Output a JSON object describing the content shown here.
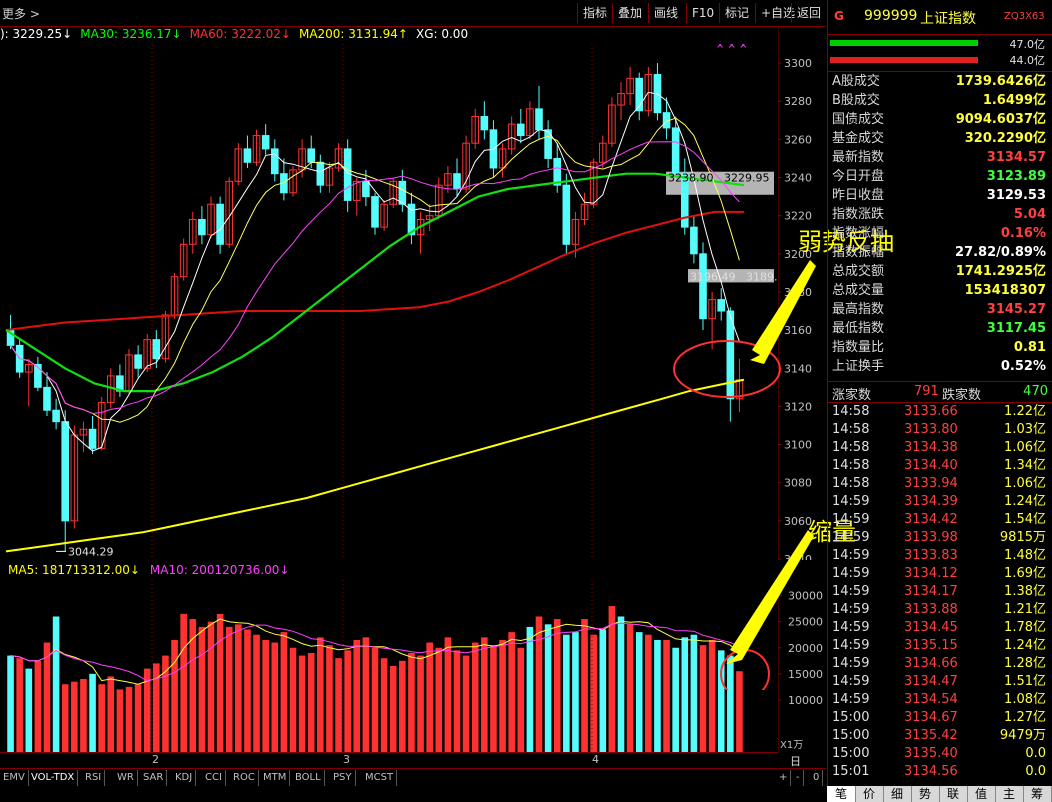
{
  "toolbar": {
    "more": "更多 >",
    "buttons": [
      "指标",
      "叠加",
      "画线",
      "F10",
      "标记",
      "+自选",
      "返回"
    ]
  },
  "ma_legend": [
    {
      "text": "): 3229.25↓",
      "color": "#ffffff"
    },
    {
      "text": "MA30: 3236.17↓",
      "color": "#00ff00"
    },
    {
      "text": "MA60: 3222.02↓",
      "color": "#ff3030"
    },
    {
      "text": "MA200: 3131.94↑",
      "color": "#ffff00"
    },
    {
      "text": "XG: 0.00",
      "color": "#ffffff"
    }
  ],
  "vol_legend": [
    {
      "text": "MA5: 181713312.00↓",
      "color": "#ffff00"
    },
    {
      "text": "MA10: 200120736.00↓",
      "color": "#ff40ff"
    }
  ],
  "price_axis": [
    "3300",
    "3280",
    "3260",
    "3240",
    "3220",
    "3200",
    "3180",
    "3160",
    "3140",
    "3120",
    "3100",
    "3080",
    "3060",
    "3040"
  ],
  "vol_axis": [
    "30000",
    "25000",
    "20000",
    "15000",
    "10000"
  ],
  "vol_unit": "X1万",
  "date_labels": [
    "2",
    "3",
    "4"
  ],
  "period": "日线",
  "chart_labels": {
    "min_label": "3044.29",
    "gap1": "3238.90",
    "gap1b": "3229.95",
    "gap2": "3196.49",
    "gap2b": "3189.",
    "marks": "× × ×"
  },
  "annotations": {
    "weak_rebound": "弱势反抽",
    "shrink_volume": "缩量"
  },
  "indicator_tabs": [
    "EMV",
    "VOL-TDX",
    "RSI",
    "WR",
    "SAR",
    "KDJ",
    "CCI",
    "ROC",
    "MTM",
    "BOLL",
    "PSY",
    "MCST"
  ],
  "indicator_nav": [
    "+",
    "-",
    "0"
  ],
  "right_panel": {
    "header_g": "G",
    "code": "999999",
    "name": "上证指数",
    "tag": "ZQ3X63",
    "ratio_up": "47.0亿",
    "ratio_dn": "44.0亿",
    "stats": [
      {
        "label": "A股成交",
        "value": "1739.6426亿",
        "color": "#ffff40"
      },
      {
        "label": "B股成交",
        "value": "1.6499亿",
        "color": "#ffff40"
      },
      {
        "label": "国债成交",
        "value": "9094.6037亿",
        "color": "#ffff40"
      },
      {
        "label": "基金成交",
        "value": "320.2290亿",
        "color": "#ffff40"
      },
      {
        "label": "最新指数",
        "value": "3134.57",
        "color": "#ff4040"
      },
      {
        "label": "今日开盘",
        "value": "3123.89",
        "color": "#40ff40"
      },
      {
        "label": "昨日收盘",
        "value": "3129.53",
        "color": "#ffffff"
      },
      {
        "label": "指数涨跌",
        "value": "5.04",
        "color": "#ff4040"
      },
      {
        "label": "指数涨幅",
        "value": "0.16%",
        "color": "#ff4040"
      },
      {
        "label": "指数振幅",
        "value": "27.82/0.89%",
        "color": "#ffffff"
      },
      {
        "label": "总成交额",
        "value": "1741.2925亿",
        "color": "#ffff40"
      },
      {
        "label": "总成交量",
        "value": "153418307",
        "color": "#ffff40"
      },
      {
        "label": "最高指数",
        "value": "3145.27",
        "color": "#ff4040"
      },
      {
        "label": "最低指数",
        "value": "3117.45",
        "color": "#40ff40"
      },
      {
        "label": "指数量比",
        "value": "0.81",
        "color": "#ffff40"
      },
      {
        "label": "上证换手",
        "value": "0.52%",
        "color": "#ffffff"
      }
    ],
    "up_label": "涨家数",
    "up_count": "791",
    "down_label": "跌家数",
    "down_count": "470",
    "ticks": [
      {
        "t": "14:58",
        "p": "3133.66",
        "v": "1.22亿"
      },
      {
        "t": "14:58",
        "p": "3133.80",
        "v": "1.03亿"
      },
      {
        "t": "14:58",
        "p": "3134.38",
        "v": "1.06亿"
      },
      {
        "t": "14:58",
        "p": "3134.40",
        "v": "1.34亿"
      },
      {
        "t": "14:58",
        "p": "3133.94",
        "v": "1.06亿"
      },
      {
        "t": "14:59",
        "p": "3134.39",
        "v": "1.24亿"
      },
      {
        "t": "14:59",
        "p": "3134.42",
        "v": "1.54亿"
      },
      {
        "t": "14:59",
        "p": "3133.98",
        "v": "9815万"
      },
      {
        "t": "14:59",
        "p": "3133.83",
        "v": "1.48亿"
      },
      {
        "t": "14:59",
        "p": "3134.12",
        "v": "1.69亿"
      },
      {
        "t": "14:59",
        "p": "3134.17",
        "v": "1.38亿"
      },
      {
        "t": "14:59",
        "p": "3133.88",
        "v": "1.21亿"
      },
      {
        "t": "14:59",
        "p": "3134.45",
        "v": "1.78亿"
      },
      {
        "t": "14:59",
        "p": "3135.15",
        "v": "1.24亿"
      },
      {
        "t": "14:59",
        "p": "3134.66",
        "v": "1.28亿"
      },
      {
        "t": "14:59",
        "p": "3134.47",
        "v": "1.51亿"
      },
      {
        "t": "14:59",
        "p": "3134.54",
        "v": "1.08亿"
      },
      {
        "t": "15:00",
        "p": "3134.67",
        "v": "1.27亿"
      },
      {
        "t": "15:00",
        "p": "3135.42",
        "v": "9479万"
      },
      {
        "t": "15:00",
        "p": "3135.40",
        "v": "0.0"
      },
      {
        "t": "15:01",
        "p": "3134.56",
        "v": "0.0"
      }
    ],
    "bottom_tabs": [
      "笔",
      "价",
      "细",
      "势",
      "联",
      "值",
      "主",
      "筹"
    ]
  },
  "chart_data": {
    "type": "candlestick",
    "price_range": [
      3040,
      3310
    ],
    "candles": [
      [
        3160,
        3168,
        3150,
        3152
      ],
      [
        3152,
        3155,
        3135,
        3138
      ],
      [
        3138,
        3145,
        3120,
        3142
      ],
      [
        3142,
        3146,
        3128,
        3130
      ],
      [
        3130,
        3138,
        3115,
        3118
      ],
      [
        3118,
        3124,
        3108,
        3112
      ],
      [
        3112,
        3118,
        3044,
        3060
      ],
      [
        3060,
        3110,
        3056,
        3105
      ],
      [
        3105,
        3112,
        3096,
        3108
      ],
      [
        3108,
        3115,
        3095,
        3098
      ],
      [
        3098,
        3125,
        3097,
        3122
      ],
      [
        3122,
        3140,
        3119,
        3136
      ],
      [
        3136,
        3142,
        3125,
        3128
      ],
      [
        3128,
        3150,
        3126,
        3147
      ],
      [
        3147,
        3152,
        3135,
        3140
      ],
      [
        3140,
        3158,
        3138,
        3155
      ],
      [
        3155,
        3160,
        3140,
        3145
      ],
      [
        3145,
        3170,
        3143,
        3168
      ],
      [
        3168,
        3190,
        3166,
        3188
      ],
      [
        3188,
        3208,
        3186,
        3205
      ],
      [
        3205,
        3222,
        3200,
        3218
      ],
      [
        3218,
        3225,
        3205,
        3210
      ],
      [
        3210,
        3230,
        3208,
        3226
      ],
      [
        3226,
        3230,
        3200,
        3205
      ],
      [
        3205,
        3240,
        3203,
        3238
      ],
      [
        3238,
        3258,
        3236,
        3255
      ],
      [
        3255,
        3262,
        3245,
        3248
      ],
      [
        3248,
        3265,
        3246,
        3262
      ],
      [
        3262,
        3268,
        3252,
        3255
      ],
      [
        3255,
        3260,
        3238,
        3242
      ],
      [
        3242,
        3250,
        3228,
        3232
      ],
      [
        3232,
        3246,
        3230,
        3244
      ],
      [
        3244,
        3260,
        3240,
        3255
      ],
      [
        3255,
        3262,
        3245,
        3248
      ],
      [
        3248,
        3252,
        3232,
        3236
      ],
      [
        3236,
        3248,
        3232,
        3245
      ],
      [
        3245,
        3258,
        3243,
        3255
      ],
      [
        3255,
        3260,
        3222,
        3228
      ],
      [
        3228,
        3240,
        3220,
        3238
      ],
      [
        3238,
        3244,
        3225,
        3230
      ],
      [
        3230,
        3232,
        3210,
        3214
      ],
      [
        3214,
        3228,
        3212,
        3226
      ],
      [
        3226,
        3240,
        3224,
        3238
      ],
      [
        3238,
        3244,
        3222,
        3226
      ],
      [
        3226,
        3232,
        3205,
        3210
      ],
      [
        3210,
        3222,
        3200,
        3218
      ],
      [
        3218,
        3226,
        3212,
        3220
      ],
      [
        3220,
        3240,
        3218,
        3236
      ],
      [
        3236,
        3246,
        3232,
        3242
      ],
      [
        3242,
        3250,
        3230,
        3234
      ],
      [
        3234,
        3262,
        3232,
        3258
      ],
      [
        3258,
        3276,
        3255,
        3272
      ],
      [
        3272,
        3280,
        3260,
        3265
      ],
      [
        3265,
        3270,
        3240,
        3245
      ],
      [
        3245,
        3258,
        3240,
        3255
      ],
      [
        3255,
        3272,
        3252,
        3268
      ],
      [
        3268,
        3276,
        3258,
        3262
      ],
      [
        3262,
        3280,
        3260,
        3276
      ],
      [
        3276,
        3288,
        3260,
        3265
      ],
      [
        3265,
        3270,
        3245,
        3250
      ],
      [
        3250,
        3258,
        3232,
        3236
      ],
      [
        3236,
        3242,
        3200,
        3205
      ],
      [
        3205,
        3222,
        3198,
        3218
      ],
      [
        3218,
        3232,
        3215,
        3226
      ],
      [
        3226,
        3250,
        3224,
        3248
      ],
      [
        3248,
        3262,
        3245,
        3258
      ],
      [
        3258,
        3282,
        3256,
        3278
      ],
      [
        3278,
        3290,
        3270,
        3284
      ],
      [
        3284,
        3298,
        3278,
        3292
      ],
      [
        3292,
        3295,
        3270,
        3275
      ],
      [
        3275,
        3298,
        3272,
        3294
      ],
      [
        3294,
        3300,
        3270,
        3274
      ],
      [
        3274,
        3282,
        3260,
        3266
      ],
      [
        3266,
        3272,
        3238,
        3242
      ],
      [
        3242,
        3250,
        3210,
        3214
      ],
      [
        3214,
        3220,
        3195,
        3200
      ],
      [
        3200,
        3206,
        3160,
        3166
      ],
      [
        3166,
        3180,
        3150,
        3176
      ],
      [
        3176,
        3182,
        3165,
        3170
      ],
      [
        3170,
        3172,
        3112,
        3124
      ],
      [
        3124,
        3145,
        3117,
        3134
      ]
    ],
    "volumes": [
      [
        18500,
        1
      ],
      [
        18000,
        0
      ],
      [
        16000,
        1
      ],
      [
        17500,
        0
      ],
      [
        21000,
        0
      ],
      [
        26000,
        1
      ],
      [
        13000,
        0
      ],
      [
        13500,
        0
      ],
      [
        14000,
        0
      ],
      [
        15000,
        1
      ],
      [
        13000,
        0
      ],
      [
        14500,
        0
      ],
      [
        12000,
        0
      ],
      [
        12500,
        0
      ],
      [
        13000,
        0
      ],
      [
        16000,
        0
      ],
      [
        17000,
        0
      ],
      [
        18500,
        0
      ],
      [
        21500,
        0
      ],
      [
        26500,
        0
      ],
      [
        25500,
        0
      ],
      [
        24000,
        0
      ],
      [
        25000,
        0
      ],
      [
        26500,
        0
      ],
      [
        24000,
        0
      ],
      [
        24500,
        0
      ],
      [
        23500,
        0
      ],
      [
        22500,
        0
      ],
      [
        21500,
        0
      ],
      [
        21000,
        0
      ],
      [
        23000,
        0
      ],
      [
        20000,
        0
      ],
      [
        18500,
        0
      ],
      [
        19000,
        0
      ],
      [
        22000,
        0
      ],
      [
        20500,
        0
      ],
      [
        18000,
        0
      ],
      [
        19500,
        0
      ],
      [
        21500,
        0
      ],
      [
        22000,
        0
      ],
      [
        20000,
        0
      ],
      [
        18000,
        0
      ],
      [
        16500,
        0
      ],
      [
        17500,
        0
      ],
      [
        19000,
        0
      ],
      [
        18500,
        0
      ],
      [
        21000,
        0
      ],
      [
        20000,
        0
      ],
      [
        22000,
        0
      ],
      [
        19500,
        0
      ],
      [
        18500,
        0
      ],
      [
        21000,
        0
      ],
      [
        22000,
        0
      ],
      [
        20500,
        0
      ],
      [
        21500,
        0
      ],
      [
        23000,
        0
      ],
      [
        20000,
        0
      ],
      [
        24000,
        1
      ],
      [
        26000,
        0
      ],
      [
        24500,
        1
      ],
      [
        25500,
        0
      ],
      [
        22500,
        1
      ],
      [
        23000,
        1
      ],
      [
        25500,
        0
      ],
      [
        22500,
        0
      ],
      [
        23500,
        1
      ],
      [
        28000,
        0
      ],
      [
        26000,
        1
      ],
      [
        24500,
        0
      ],
      [
        23000,
        1
      ],
      [
        22500,
        0
      ],
      [
        21500,
        1
      ],
      [
        21500,
        0
      ],
      [
        20000,
        1
      ],
      [
        22000,
        1
      ],
      [
        22500,
        1
      ],
      [
        20500,
        0
      ],
      [
        21500,
        0
      ],
      [
        19500,
        1
      ],
      [
        18500,
        1
      ],
      [
        15500,
        0
      ]
    ],
    "vol_range": [
      0,
      33000
    ],
    "ma200": [
      3044,
      3046,
      3048,
      3050,
      3052,
      3054,
      3057,
      3060,
      3063,
      3066,
      3069,
      3072,
      3076,
      3080,
      3084,
      3088,
      3092,
      3096,
      3100,
      3104,
      3108,
      3112,
      3116,
      3120,
      3124,
      3128,
      3131,
      3134
    ],
    "ma60": [
      3160,
      3162,
      3164,
      3165,
      3166,
      3167,
      3168,
      3169,
      3170,
      3170,
      3170,
      3170,
      3170,
      3171,
      3172,
      3175,
      3180,
      3186,
      3193,
      3200,
      3206,
      3211,
      3215,
      3219,
      3222,
      3222
    ],
    "ma30": [
      3160,
      3150,
      3140,
      3132,
      3128,
      3128,
      3132,
      3138,
      3146,
      3156,
      3168,
      3180,
      3192,
      3204,
      3214,
      3222,
      3230,
      3234,
      3236,
      3238,
      3240,
      3242,
      3242,
      3240,
      3238,
      3236
    ]
  }
}
